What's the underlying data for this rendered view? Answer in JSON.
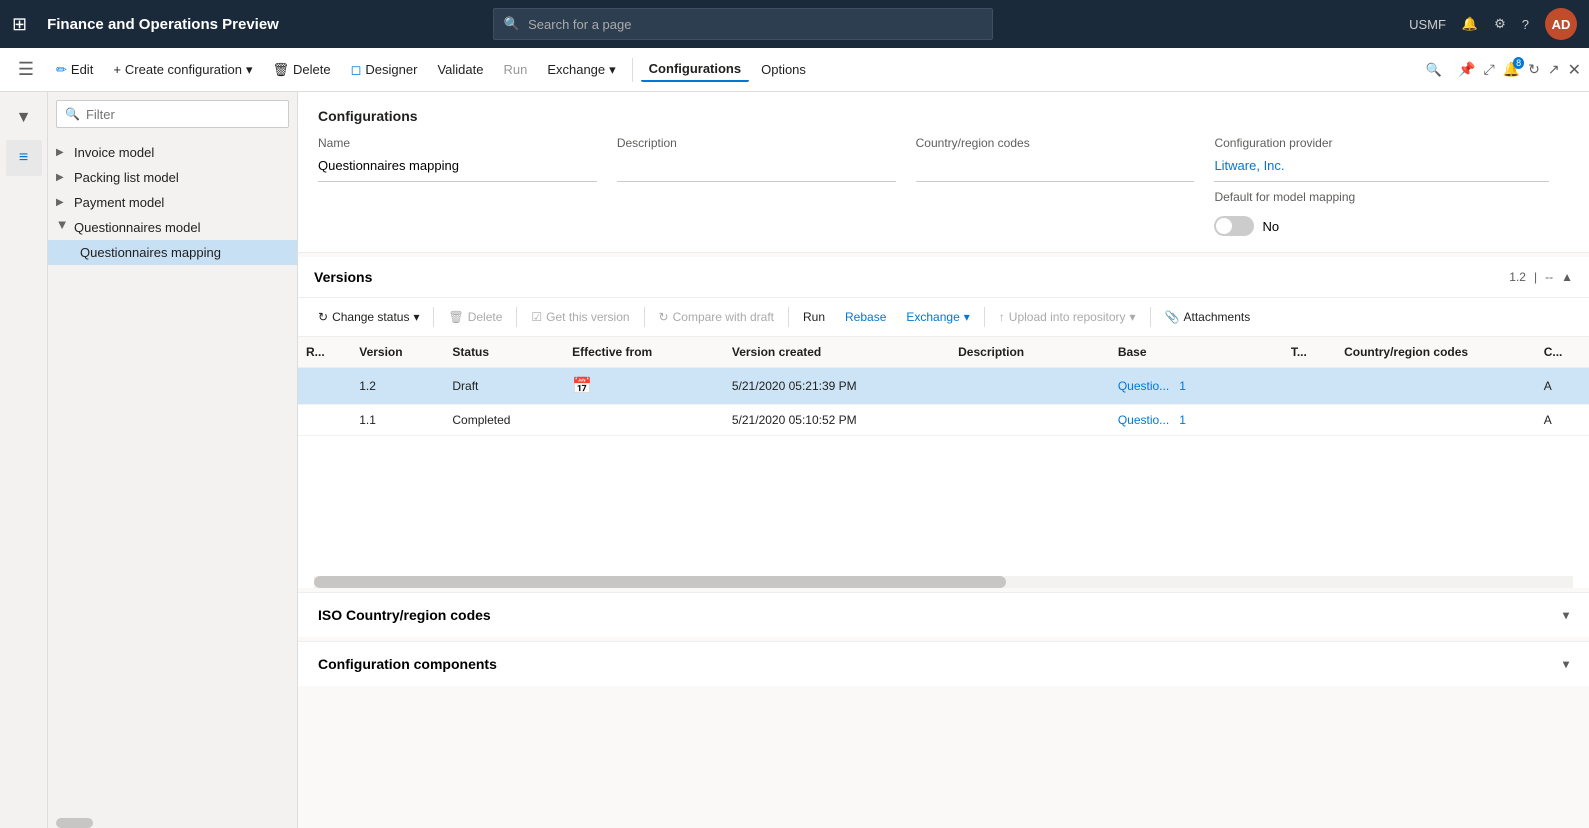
{
  "app": {
    "title": "Finance and Operations Preview",
    "search_placeholder": "Search for a page",
    "user": "USMF",
    "avatar": "AD"
  },
  "action_bar": {
    "edit": "Edit",
    "create_configuration": "Create configuration",
    "delete": "Delete",
    "designer": "Designer",
    "validate": "Validate",
    "run": "Run",
    "exchange": "Exchange",
    "configurations": "Configurations",
    "options": "Options"
  },
  "sidebar_icons": [
    {
      "name": "home-icon",
      "icon": "⌂"
    },
    {
      "name": "favorites-icon",
      "icon": "★"
    },
    {
      "name": "recent-icon",
      "icon": "◷"
    },
    {
      "name": "workspaces-icon",
      "icon": "⊞"
    },
    {
      "name": "list-icon",
      "icon": "☰"
    }
  ],
  "tree": {
    "filter_placeholder": "Filter",
    "items": [
      {
        "label": "Invoice model",
        "expanded": false,
        "selected": false,
        "indent": 0
      },
      {
        "label": "Packing list model",
        "expanded": false,
        "selected": false,
        "indent": 0
      },
      {
        "label": "Payment model",
        "expanded": false,
        "selected": false,
        "indent": 0
      },
      {
        "label": "Questionnaires model",
        "expanded": true,
        "selected": false,
        "indent": 0
      },
      {
        "label": "Questionnaires mapping",
        "expanded": false,
        "selected": true,
        "indent": 1
      }
    ]
  },
  "configurations": {
    "section_title": "Configurations",
    "fields": {
      "name_label": "Name",
      "name_value": "Questionnaires mapping",
      "description_label": "Description",
      "description_value": "",
      "country_label": "Country/region codes",
      "country_value": "",
      "provider_label": "Configuration provider",
      "provider_value": "Litware, Inc.",
      "model_mapping_label": "Default for model mapping",
      "model_mapping_value": "No"
    }
  },
  "versions": {
    "section_title": "Versions",
    "version_num": "1.2",
    "toolbar": {
      "change_status": "Change status",
      "delete": "Delete",
      "get_this_version": "Get this version",
      "compare_with_draft": "Compare with draft",
      "run": "Run",
      "rebase": "Rebase",
      "exchange": "Exchange",
      "upload_into_repository": "Upload into repository",
      "attachments": "Attachments"
    },
    "table": {
      "columns": [
        "R...",
        "Version",
        "Status",
        "Effective from",
        "Version created",
        "Description",
        "Base",
        "T...",
        "Country/region codes",
        "C..."
      ],
      "rows": [
        {
          "r": "",
          "version": "1.2",
          "status": "Draft",
          "effective_from": "",
          "version_created": "5/21/2020 05:21:39 PM",
          "description": "",
          "base": "Questio...",
          "base_num": "1",
          "t": "",
          "country": "",
          "c": "A",
          "selected": true
        },
        {
          "r": "",
          "version": "1.1",
          "status": "Completed",
          "effective_from": "",
          "version_created": "5/21/2020 05:10:52 PM",
          "description": "",
          "base": "Questio...",
          "base_num": "1",
          "t": "",
          "country": "",
          "c": "A",
          "selected": false
        }
      ]
    }
  },
  "iso_section": {
    "title": "ISO Country/region codes"
  },
  "components_section": {
    "title": "Configuration components"
  }
}
